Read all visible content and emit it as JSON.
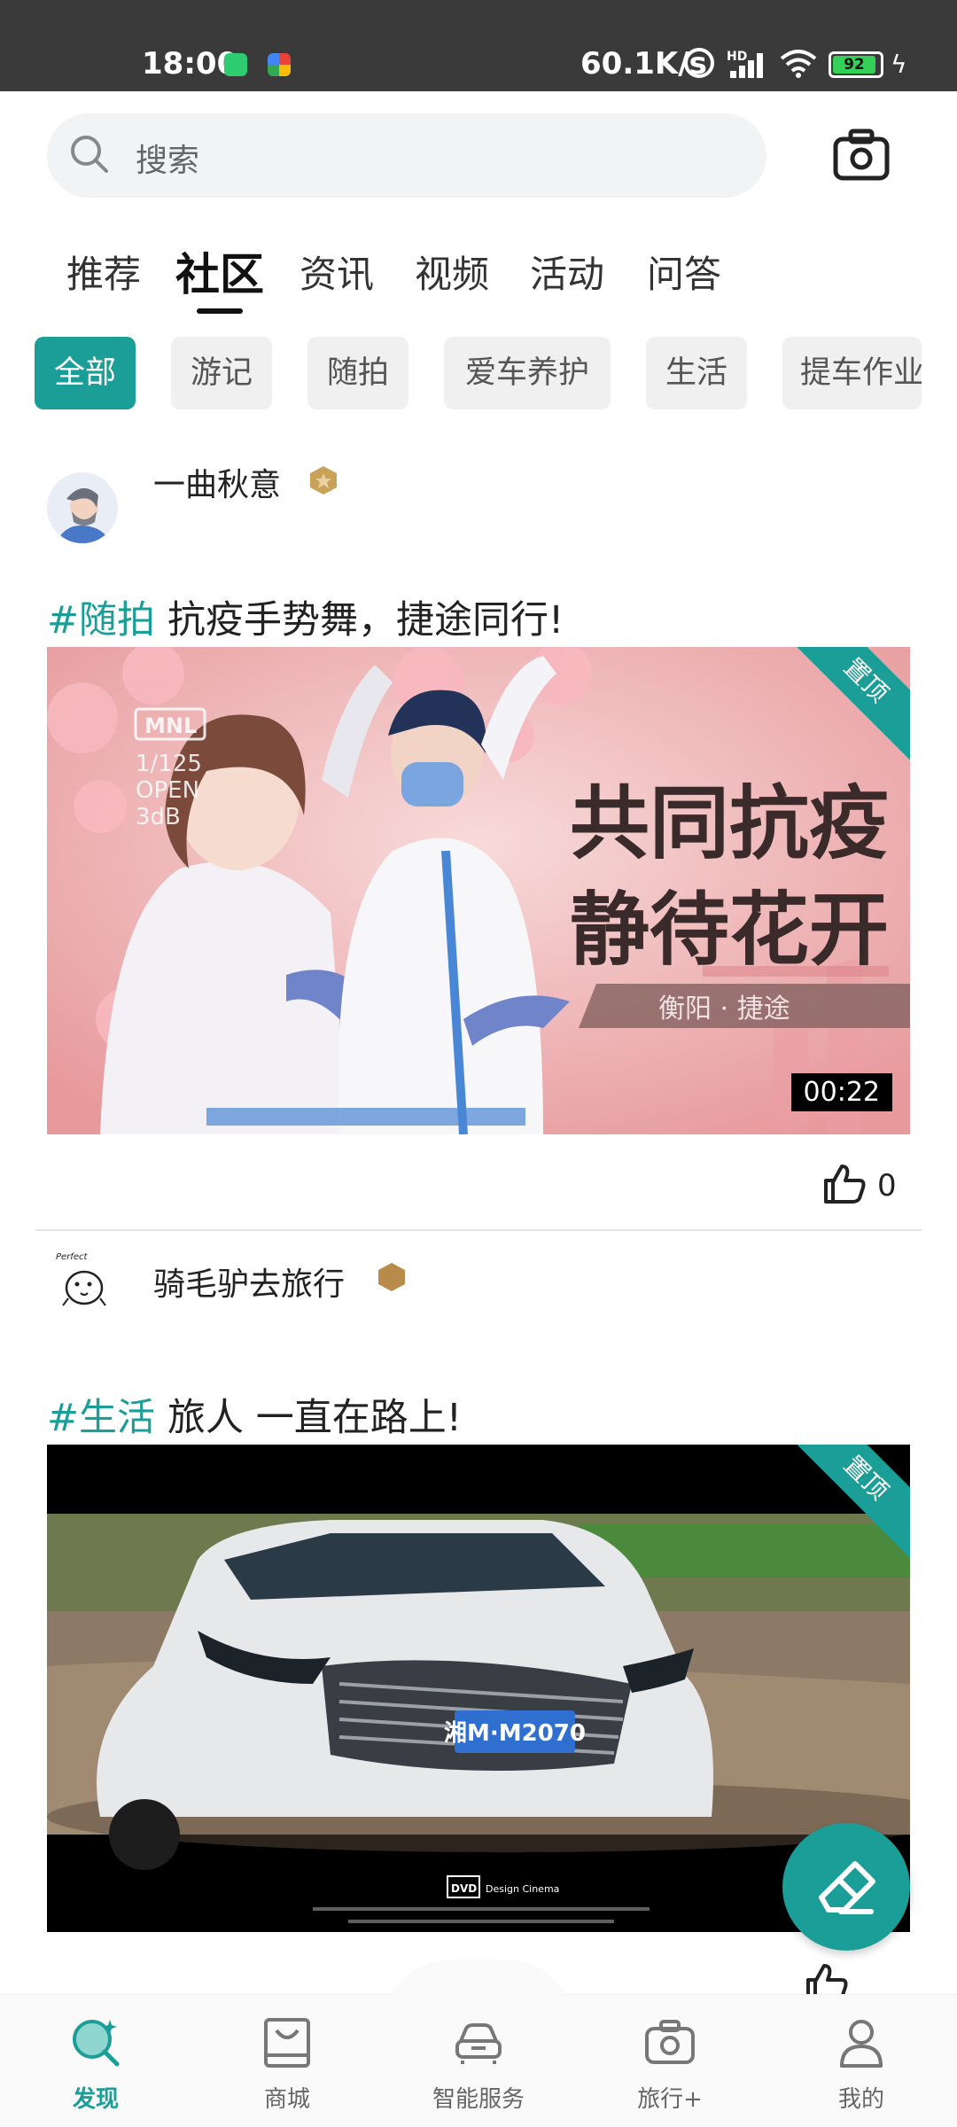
{
  "status_bar": {
    "time": "18:00",
    "network_speed": "60.1K/s",
    "network_type": "HD",
    "battery": "92"
  },
  "search": {
    "placeholder": "搜索"
  },
  "tabs": [
    {
      "label": "推荐",
      "active": false
    },
    {
      "label": "社区",
      "active": true
    },
    {
      "label": "资讯",
      "active": false
    },
    {
      "label": "视频",
      "active": false
    },
    {
      "label": "活动",
      "active": false
    },
    {
      "label": "问答",
      "active": false
    }
  ],
  "chips": [
    {
      "label": "全部",
      "active": true
    },
    {
      "label": "游记",
      "active": false
    },
    {
      "label": "随拍",
      "active": false
    },
    {
      "label": "爱车养护",
      "active": false
    },
    {
      "label": "生活",
      "active": false
    },
    {
      "label": "提车作业",
      "active": false
    }
  ],
  "posts": [
    {
      "username": "一曲秋意",
      "tag": "#随拍",
      "title": "抗疫手势舞，捷途同行!",
      "pinned_label": "置顶",
      "duration": "00:22",
      "image_text": {
        "line1": "共同抗疫",
        "line2": "静待花开",
        "caption": "衡阳 · 捷途",
        "cam": [
          "MNL",
          "1/125",
          "OPEN",
          "3dB"
        ]
      },
      "likes": "0"
    },
    {
      "username": "骑毛驴去旅行",
      "tag": "#生活",
      "title": "旅人 一直在路上!",
      "pinned_label": "置顶",
      "image_text": {
        "plate": "湘M·M2070",
        "watermark": "Design Cinema",
        "dvd": "DVD",
        "avatar_text": "Perfect"
      },
      "likes": ""
    }
  ],
  "bottom_nav": [
    {
      "label": "发现",
      "icon": "discover-icon",
      "active": true
    },
    {
      "label": "商城",
      "icon": "shop-bag-icon",
      "active": false
    },
    {
      "label": "智能服务",
      "icon": "car-service-icon",
      "active": false
    },
    {
      "label": "旅行+",
      "icon": "travel-camera-icon",
      "active": false
    },
    {
      "label": "我的",
      "icon": "profile-icon",
      "active": false
    }
  ],
  "colors": {
    "accent": "#1a9e97",
    "status_bar": "#3a3a3a",
    "battery": "#34d058"
  }
}
